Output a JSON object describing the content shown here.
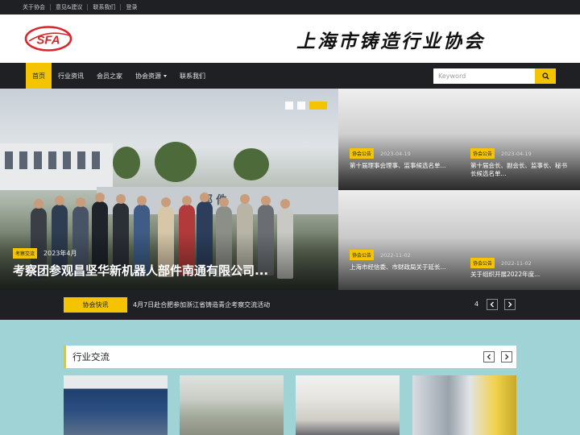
{
  "topbar": {
    "links": [
      "关于协会",
      "意见&建议",
      "联系我们",
      "登录"
    ]
  },
  "header": {
    "logo_text": "SFA",
    "site_title": "上海市铸造行业协会"
  },
  "nav": {
    "items": [
      {
        "label": "首页",
        "active": true
      },
      {
        "label": "行业资讯",
        "active": false
      },
      {
        "label": "会员之家",
        "active": false
      },
      {
        "label": "协会资源",
        "active": false,
        "dropdown": true
      },
      {
        "label": "联系我们",
        "active": false
      }
    ],
    "search_placeholder": "Keyword"
  },
  "hero": {
    "tag": "考察交流",
    "date": "2023年4月",
    "title": "考察团参观昌坚华新机器人部件南通有限公司...",
    "slides": 3,
    "active_slide": 3,
    "scene_text": "部件"
  },
  "side_posts": [
    {
      "tag": "协会公告",
      "date": "2023-04-19",
      "title": "第十届理事会理事、监事候选名单..."
    },
    {
      "tag": "协会公告",
      "date": "2023-04-19",
      "title": "第十届会长、副会长、监事长、秘书长候选名单..."
    },
    {
      "tag": "协会公告",
      "date": "2022-11-02",
      "title": "上海市经信委、市财政局关于延长..."
    },
    {
      "tag": "协会公告",
      "date": "2022-11-02",
      "title": "关于组织开展2022年度..."
    }
  ],
  "ticker": {
    "label": "协会快讯",
    "text": "4月7日赴合肥参加浙江省铸造青企考察交流活动",
    "count": "4"
  },
  "section": {
    "title": "行业交流"
  },
  "icons": {
    "search": "search-icon",
    "prev": "chevron-left-icon",
    "next": "chevron-right-icon"
  },
  "colors": {
    "accent": "#f5c400",
    "dark": "#1e2024",
    "section_bg": "#9fd3d6",
    "logo_red": "#d8262b"
  }
}
